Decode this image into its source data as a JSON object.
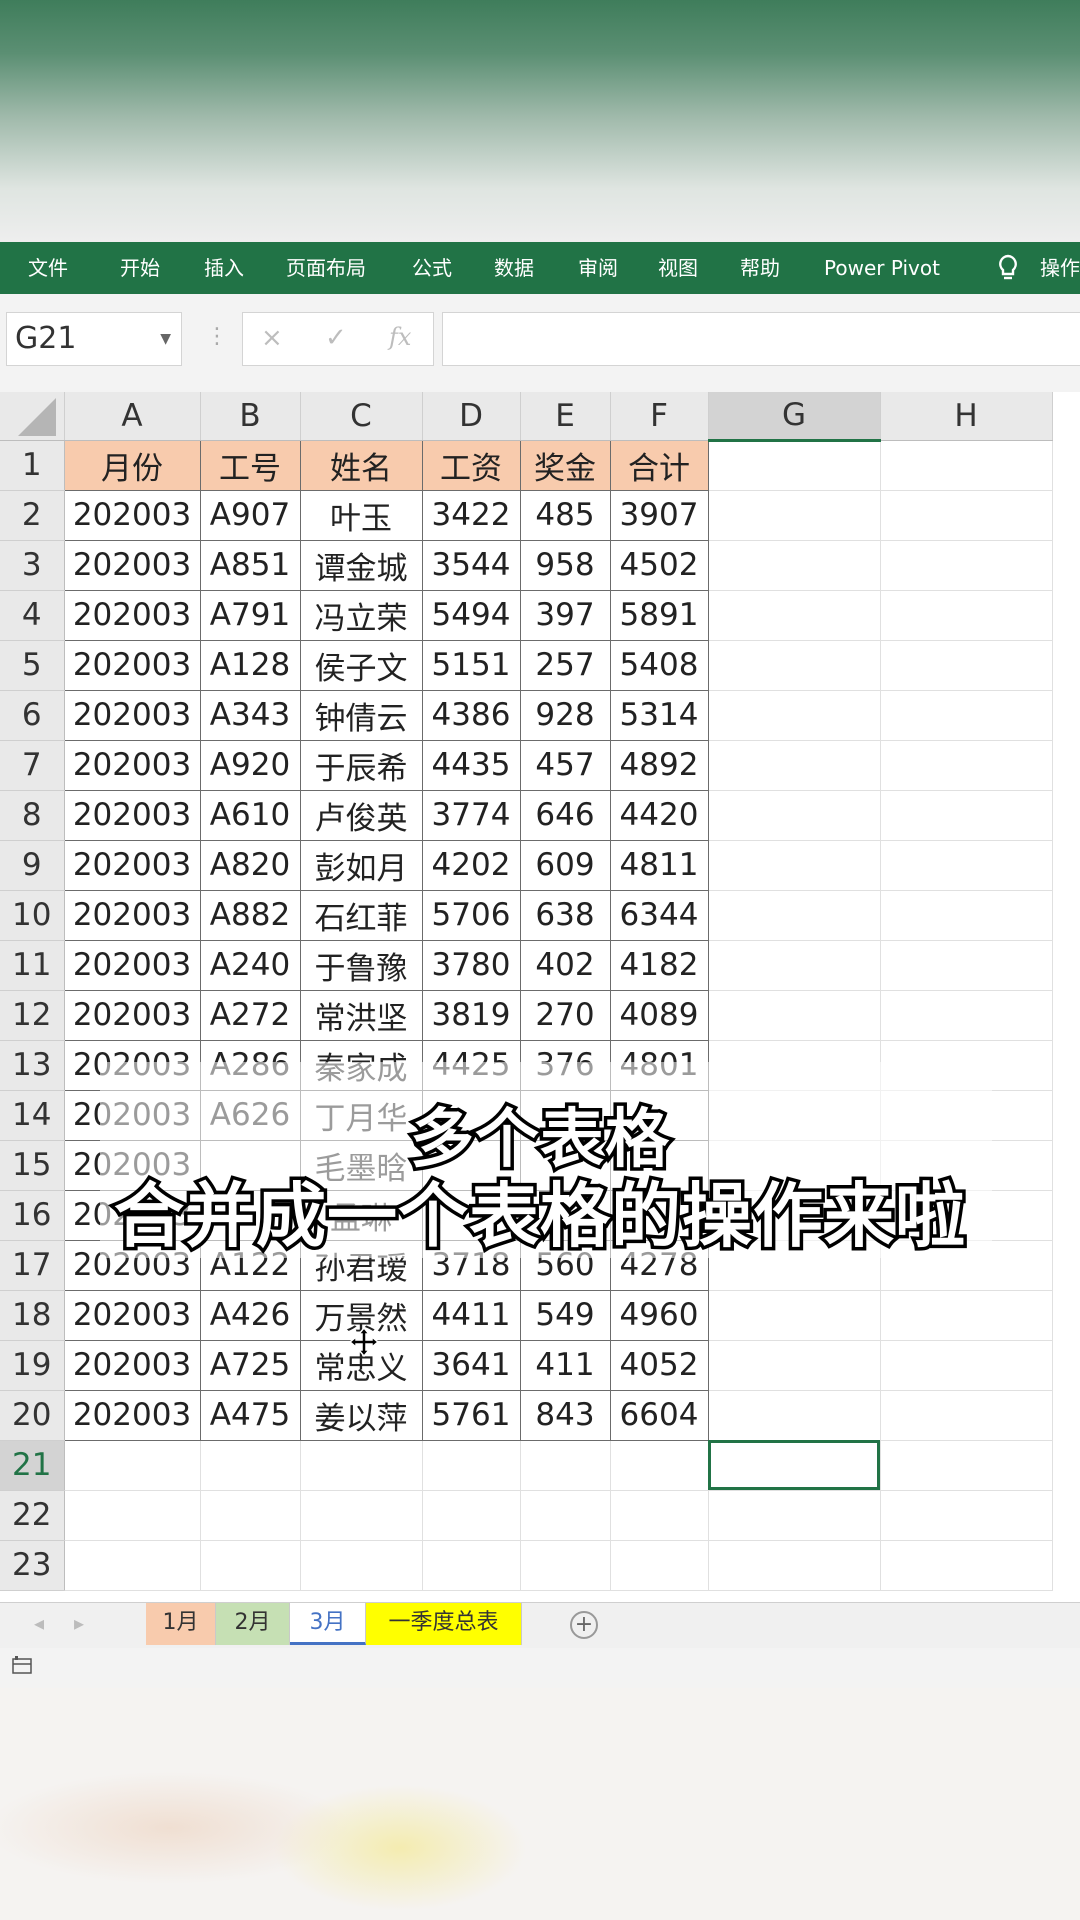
{
  "ribbon": {
    "tabs": [
      "文件",
      "开始",
      "插入",
      "页面布局",
      "公式",
      "数据",
      "审阅",
      "视图",
      "帮助",
      "Power Pivot",
      "操作"
    ]
  },
  "formula_bar": {
    "name_box": "G21",
    "fx_label": "fx",
    "cancel_symbol": "×",
    "enter_symbol": "✓",
    "content": ""
  },
  "sheet": {
    "columns": [
      "A",
      "B",
      "C",
      "D",
      "E",
      "F",
      "G",
      "H"
    ],
    "headers": [
      "月份",
      "工号",
      "姓名",
      "工资",
      "奖金",
      "合计"
    ],
    "rows": [
      [
        "202003",
        "A907",
        "叶玉",
        "3422",
        "485",
        "3907"
      ],
      [
        "202003",
        "A851",
        "谭金城",
        "3544",
        "958",
        "4502"
      ],
      [
        "202003",
        "A791",
        "冯立荣",
        "5494",
        "397",
        "5891"
      ],
      [
        "202003",
        "A128",
        "侯子文",
        "5151",
        "257",
        "5408"
      ],
      [
        "202003",
        "A343",
        "钟倩云",
        "4386",
        "928",
        "5314"
      ],
      [
        "202003",
        "A920",
        "于辰希",
        "4435",
        "457",
        "4892"
      ],
      [
        "202003",
        "A610",
        "卢俊英",
        "3774",
        "646",
        "4420"
      ],
      [
        "202003",
        "A820",
        "彭如月",
        "4202",
        "609",
        "4811"
      ],
      [
        "202003",
        "A882",
        "石红菲",
        "5706",
        "638",
        "6344"
      ],
      [
        "202003",
        "A240",
        "于鲁豫",
        "3780",
        "402",
        "4182"
      ],
      [
        "202003",
        "A272",
        "常洪坚",
        "3819",
        "270",
        "4089"
      ],
      [
        "202003",
        "A286",
        "秦家成",
        "4425",
        "376",
        "4801"
      ],
      [
        "202003",
        "A626",
        "丁月华",
        "",
        "",
        ""
      ],
      [
        "202003",
        "",
        "毛墨晗",
        "",
        "",
        ""
      ],
      [
        "202003",
        "",
        "孟琳",
        "",
        "",
        ""
      ],
      [
        "202003",
        "A122",
        "孙君瑷",
        "3718",
        "560",
        "4278"
      ],
      [
        "202003",
        "A426",
        "万景然",
        "4411",
        "549",
        "4960"
      ],
      [
        "202003",
        "A725",
        "常忠义",
        "3641",
        "411",
        "4052"
      ],
      [
        "202003",
        "A475",
        "姜以萍",
        "5761",
        "843",
        "6604"
      ]
    ],
    "row_numbers": [
      "1",
      "2",
      "3",
      "4",
      "5",
      "6",
      "7",
      "8",
      "9",
      "10",
      "11",
      "12",
      "13",
      "14",
      "15",
      "16",
      "17",
      "18",
      "19",
      "20",
      "21",
      "22",
      "23"
    ],
    "active_cell": "G21"
  },
  "sheet_tabs": [
    {
      "label": "1月",
      "color": "#f8cbad"
    },
    {
      "label": "2月",
      "color": "#c6e0b4"
    },
    {
      "label": "3月",
      "color": "#ffffff"
    },
    {
      "label": "一季度总表",
      "color": "#ffff00"
    }
  ],
  "caption": {
    "line1": "多个表格",
    "line2": "合并成一个表格的操作来啦"
  },
  "colors": {
    "ribbon": "#217346",
    "header_fill": "#f8cbad",
    "active_border": "#217346"
  }
}
